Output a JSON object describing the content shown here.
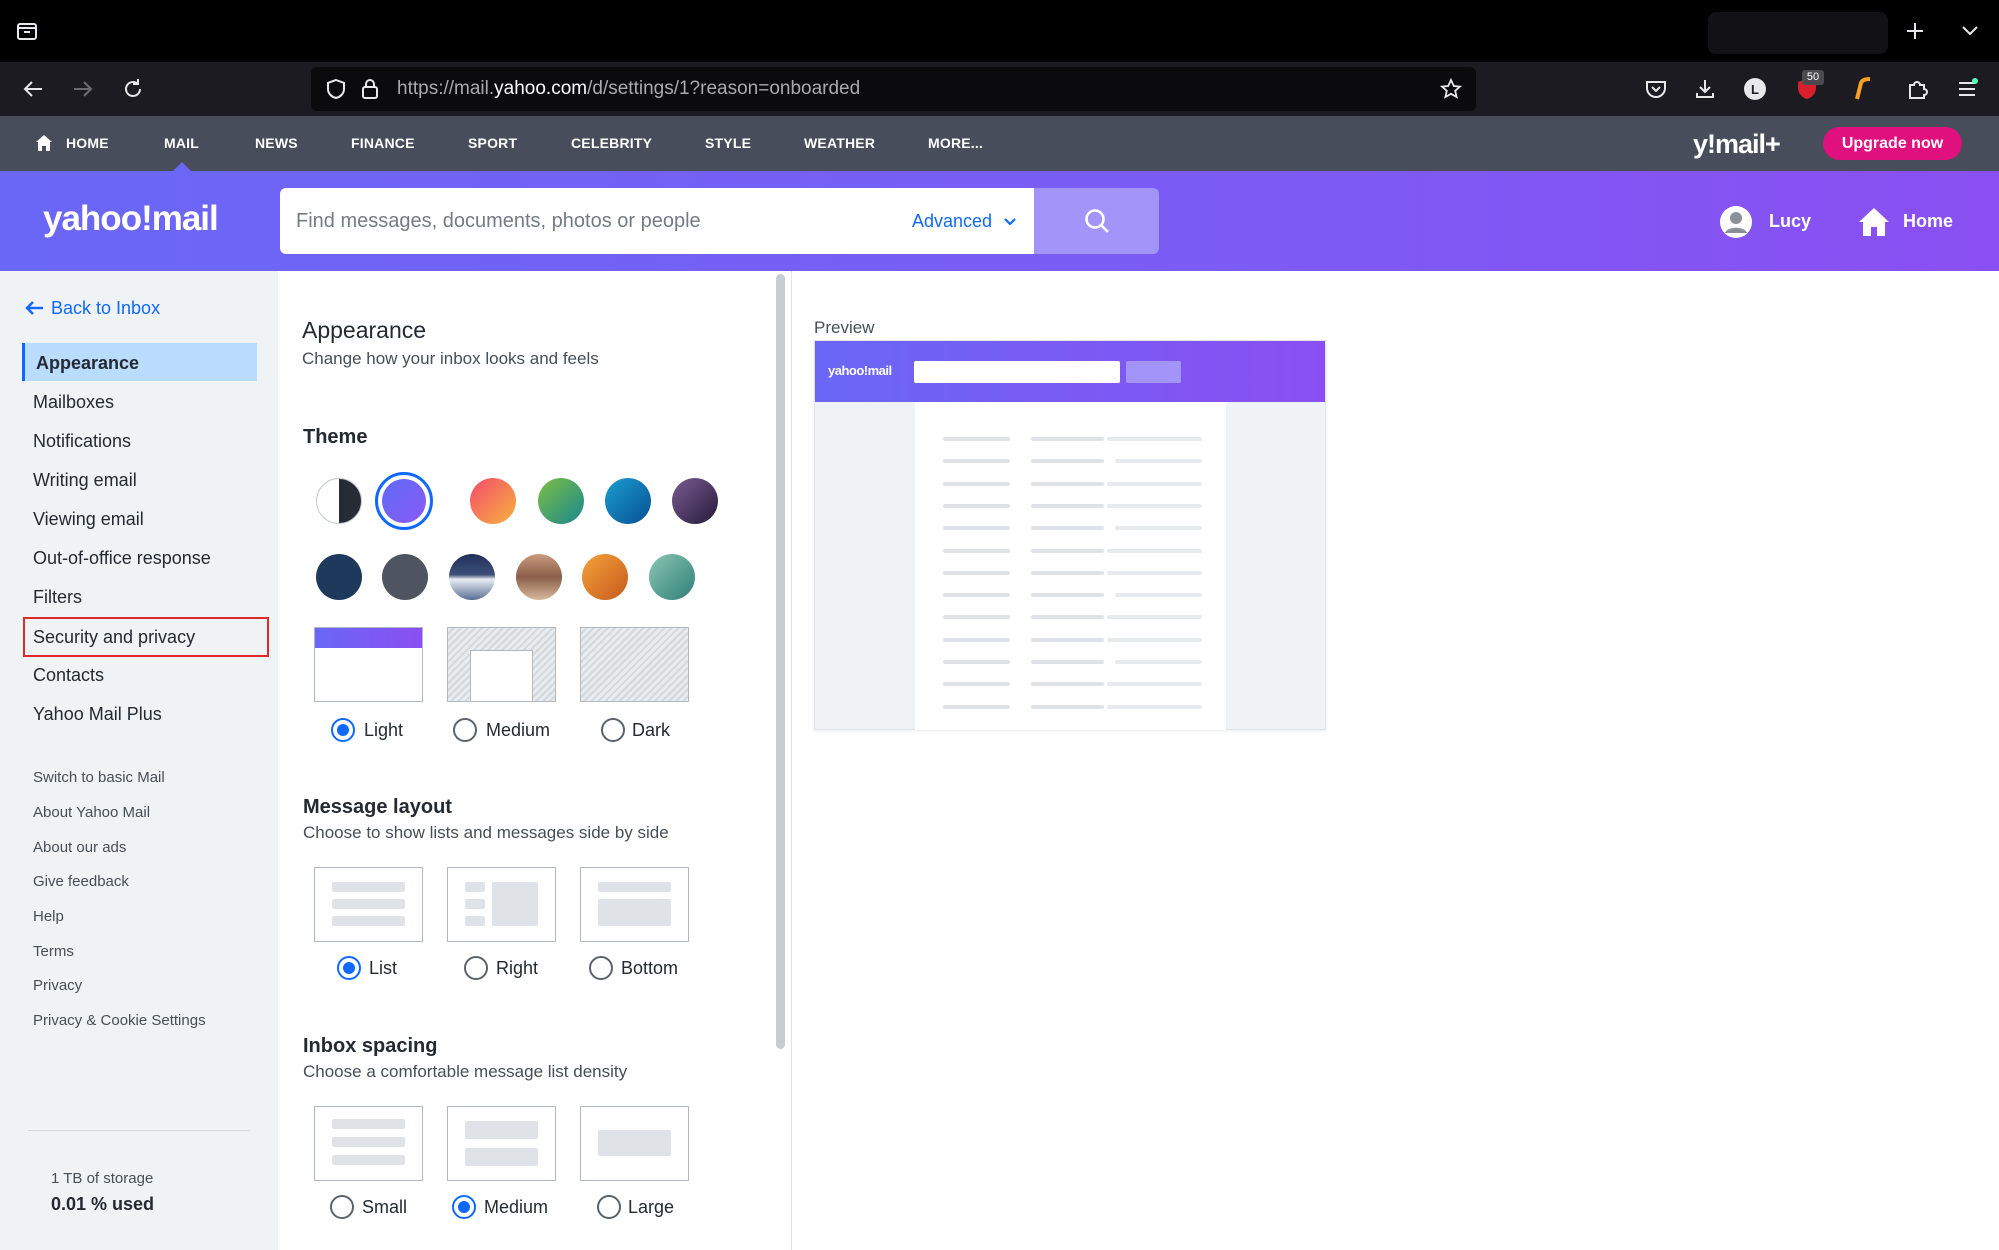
{
  "browser": {
    "url_prefix": "https://mail.",
    "url_domain": "yahoo.com",
    "url_path": "/d/settings/1?reason=onboarded",
    "extension_badge": "50"
  },
  "topnav": {
    "items": [
      "HOME",
      "MAIL",
      "NEWS",
      "FINANCE",
      "SPORT",
      "CELEBRITY",
      "STYLE",
      "WEATHER",
      "MORE..."
    ],
    "active": "MAIL",
    "brand": "y!mail+",
    "upgrade_label": "Upgrade now"
  },
  "header": {
    "logo": "yahoo!mail",
    "search_placeholder": "Find messages, documents, photos or people",
    "advanced_label": "Advanced",
    "user_name": "Lucy",
    "home_label": "Home"
  },
  "sidebar": {
    "back_label": "Back to Inbox",
    "items": [
      "Appearance",
      "Mailboxes",
      "Notifications",
      "Writing email",
      "Viewing email",
      "Out-of-office response",
      "Filters",
      "Security and privacy",
      "Contacts",
      "Yahoo Mail Plus"
    ],
    "active": "Appearance",
    "highlighted": "Security and privacy",
    "links": [
      "Switch to basic Mail",
      "About Yahoo Mail",
      "About our ads",
      "Give feedback",
      "Help",
      "Terms",
      "Privacy",
      "Privacy & Cookie Settings"
    ],
    "storage_label": "1 TB of storage",
    "storage_used": "0.01 % used"
  },
  "appearance": {
    "title": "Appearance",
    "subtitle": "Change how your inbox looks and feels",
    "theme": {
      "heading": "Theme",
      "swatches_row1": [
        "#ffffff",
        "#6f68f6",
        "#f6755a",
        "#3aa46a",
        "#0d6fb1",
        "#4c3a68"
      ],
      "swatches_row2": [
        "#1e3a5f",
        "#4e5560",
        "#3b4a6b",
        "#a07a62",
        "#d97a2b",
        "#4e9c8c"
      ],
      "selected_swatch": 1,
      "modes": [
        "Light",
        "Medium",
        "Dark"
      ],
      "selected_mode": "Light"
    },
    "layout": {
      "heading": "Message layout",
      "subtitle": "Choose to show lists and messages side by side",
      "options": [
        "List",
        "Right",
        "Bottom"
      ],
      "selected": "List"
    },
    "spacing": {
      "heading": "Inbox spacing",
      "subtitle": "Choose a comfortable message list density",
      "options": [
        "Small",
        "Medium",
        "Large"
      ],
      "selected": "Medium"
    }
  },
  "preview": {
    "label": "Preview",
    "logo": "yahoo!mail"
  },
  "colors": {
    "accent_blue": "#0f69ff",
    "header_purple": "#7b5cf5",
    "upgrade_pink": "#e0117e",
    "highlight_red": "#e0292b"
  }
}
